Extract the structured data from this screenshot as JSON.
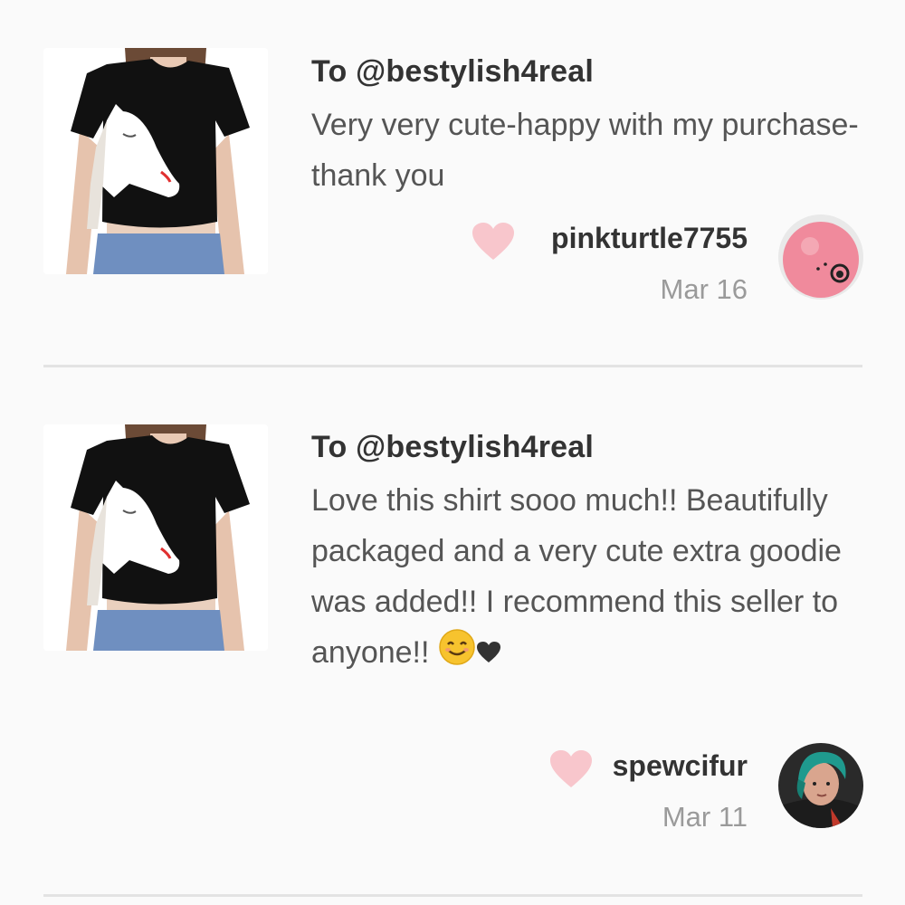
{
  "reviews": [
    {
      "to": "To @bestylish4real",
      "message": "Very very cute-happy with my purchase-thank you",
      "username": "pinkturtle7755",
      "date": "Mar 16",
      "product_image": "black-cropped-tee-white-horse",
      "avatar_icon": "pink-ball-avatar"
    },
    {
      "to": "To @bestylish4real",
      "message": "Love this shirt sooo much!! Beautifully packaged and a very cute extra goodie was added!! I recommend this seller to anyone!!",
      "message_emojis": [
        "smiling-face-emoji",
        "heart-emoji"
      ],
      "username": "spewcifur",
      "date": "Mar 11",
      "product_image": "black-cropped-tee-white-horse",
      "avatar_icon": "green-hair-person-avatar"
    }
  ],
  "colors": {
    "background": "#fafafa",
    "heart": "#f8c6cc",
    "username": "#333333",
    "date": "#9a9a9a"
  }
}
